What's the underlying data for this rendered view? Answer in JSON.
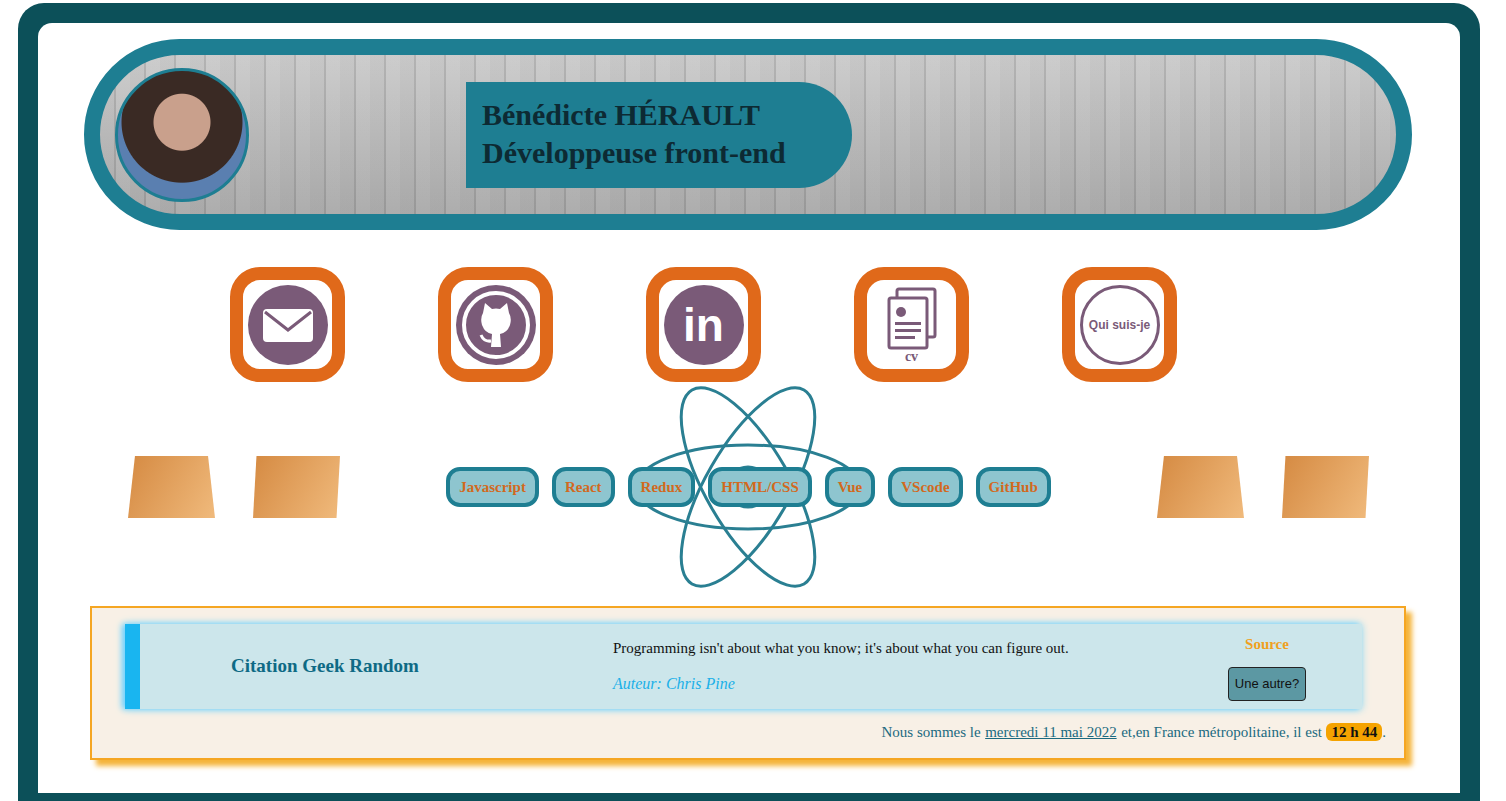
{
  "header": {
    "name": "Bénédicte HÉRAULT",
    "role": "Développeuse front-end"
  },
  "links": [
    {
      "kind": "mail"
    },
    {
      "kind": "github"
    },
    {
      "kind": "linkedin",
      "text": "in"
    },
    {
      "kind": "cv",
      "text": "cv"
    },
    {
      "kind": "about",
      "text": "Qui suis-je"
    }
  ],
  "skills": [
    "Javascript",
    "React",
    "Redux",
    "HTML/CSS",
    "Vue",
    "VScode",
    "GitHub"
  ],
  "quote": {
    "title": "Citation Geek Random",
    "text": "Programming isn't about what you know; it's about what you can figure out.",
    "author": "Auteur: Chris Pine",
    "source": "Source",
    "button": "Une autre?"
  },
  "clock": {
    "prefix": "Nous sommes le",
    "date": "mercredi 11 mai 2022",
    "middle": "et,en France métropolitaine, il est",
    "time": "12 h 44",
    "suffix": "."
  }
}
